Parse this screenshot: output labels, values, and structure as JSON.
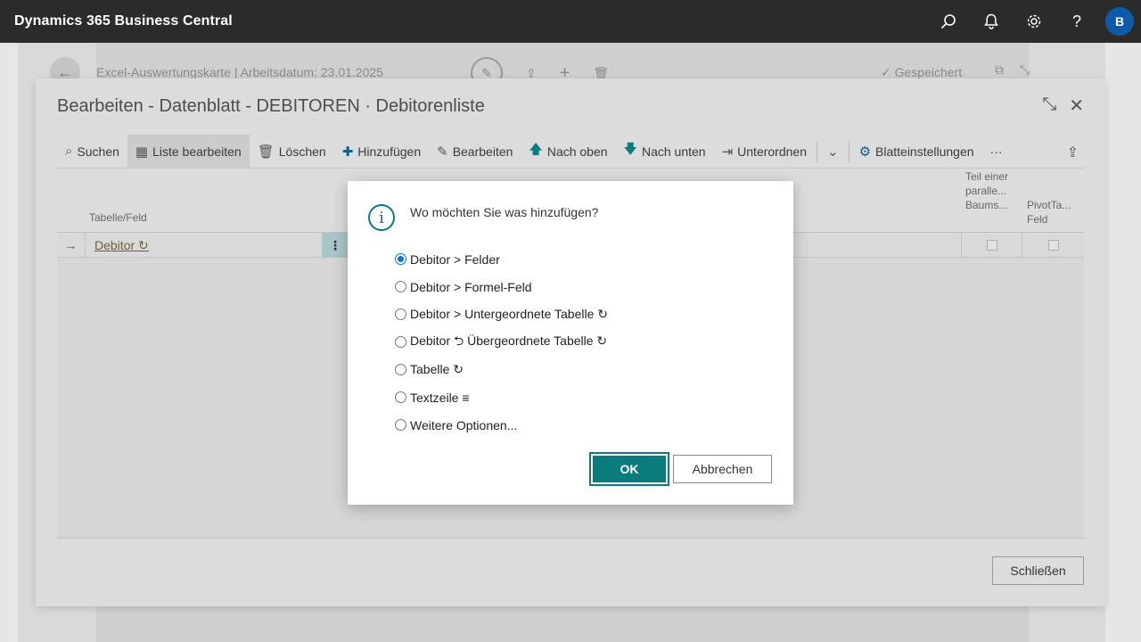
{
  "app": {
    "title": "Dynamics 365 Business Central",
    "avatar_initial": "B"
  },
  "appbar_icons": [
    "search-icon",
    "bell-icon",
    "gear-icon",
    "help-icon"
  ],
  "background_page": {
    "breadcrumb": "Excel-Auswertungskarte | Arbeitsdatum: 23.01.2025",
    "saved_label": "✓ Gespeichert"
  },
  "sheet": {
    "title": "Bearbeiten - Datenblatt - DEBITOREN · Debitorenliste",
    "toolbar": {
      "search": "Suchen",
      "edit_list": "Liste bearbeiten",
      "delete": "Löschen",
      "add": "Hinzufügen",
      "edit": "Bearbeiten",
      "move_up": "Nach oben",
      "move_down": "Nach unten",
      "indent": "Unterordnen",
      "sheet_settings": "Blatteinstellungen",
      "more": "···"
    },
    "columns": {
      "table_field": "Tabelle/Feld",
      "parallel_tree": "Teil einer paralle... Baums...",
      "pivot_field": "PivotTa... Feld"
    },
    "rows": [
      {
        "label": "Debitor ↻"
      }
    ],
    "close_label": "Schließen"
  },
  "dialog": {
    "question": "Wo möchten Sie was hinzufügen?",
    "options": [
      {
        "label": "Debitor > Felder",
        "checked": true
      },
      {
        "label": "Debitor > Formel-Feld",
        "checked": false
      },
      {
        "label": "Debitor > Untergeordnete Tabelle ↻",
        "checked": false
      },
      {
        "label": "Debitor ⮌ Übergeordnete Tabelle ↻",
        "checked": false
      },
      {
        "label": "Tabelle ↻",
        "checked": false
      },
      {
        "label": "Textzeile ≡",
        "checked": false
      },
      {
        "label": "Weitere Optionen...",
        "checked": false
      }
    ],
    "ok_label": "OK",
    "cancel_label": "Abbrechen"
  },
  "colors": {
    "accent": "#0b7c7e",
    "radio": "#0078d4",
    "appbar": "#2b2b2b"
  }
}
